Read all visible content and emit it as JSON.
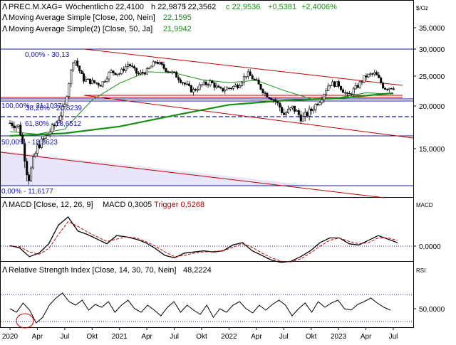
{
  "header": {
    "symbol": "PREC.M.XAG=",
    "interval": "Wöchentlich",
    "open": "o 22,4100",
    "high": "h 22,9875",
    "low": "l 22,3562",
    "close": "c 22,9536",
    "change": "+0,5381",
    "change_pct": "+2,4006%"
  },
  "legend": {
    "ma200": {
      "label": "Moving Average Simple [Close, 200, Nein]",
      "value": "22,1595"
    },
    "ma50": {
      "label": "Moving Average Simple(2) [Close, 50, Ja]",
      "value": "21,9942"
    }
  },
  "macd_title": {
    "label": "MACD [Close, 12, 26, 9]",
    "macd": "MACD 0,3005",
    "trigger": "Trigger 0,5268"
  },
  "rsi_title": {
    "label": "Relative Strength Index [Close, 14, 30, 70, Nein]",
    "value": "48,2224"
  },
  "units": {
    "price": "$/Oz",
    "macd": "MACD",
    "rsi": "RSI"
  },
  "price_ticks": [
    "35,0000",
    "30,0000",
    "25,0000",
    "20,0000",
    "15,0000"
  ],
  "macd_ticks": [
    "0,0000"
  ],
  "rsi_ticks": [
    "50,0000"
  ],
  "x_labels": [
    "2020",
    "Apr",
    "Jul",
    "Okt",
    "2021",
    "Apr",
    "Jul",
    "Okt",
    "2022",
    "Apr",
    "Jul",
    "Okt",
    "2023",
    "Apr",
    "Jul"
  ],
  "fib_labels": {
    "f0": "0,00% - 30,13",
    "f382": "38,20% - 20,8239",
    "f50": "50,00% - 18,3623",
    "f618": "61,80% - 18,6512",
    "f100": "100,00% - 21,1037",
    "fbottom": "0,00% - 11,6177"
  },
  "colors": {
    "candle": "#000000",
    "ma200": "#159015",
    "ma50": "#159015",
    "channel": "#c00000",
    "fib": "#1a1aa0",
    "macd": "#000000",
    "trigger": "#c00000",
    "rsi": "#000000"
  },
  "chart_data": [
    {
      "type": "candlestick",
      "title": "PREC.M.XAG=",
      "interval": "weekly",
      "ylim": [
        10.8,
        38.2
      ],
      "x": [
        "2020-01",
        "2020-04",
        "2020-07",
        "2020-10",
        "2021-01",
        "2021-04",
        "2021-07",
        "2021-10",
        "2022-01",
        "2022-04",
        "2022-07",
        "2022-10",
        "2023-01",
        "2023-04",
        "2023-07"
      ],
      "close_path": [
        [
          "2020-01",
          18.0
        ],
        [
          "2020-02",
          17.6
        ],
        [
          "2020-03",
          12.3
        ],
        [
          "2020-04",
          15.2
        ],
        [
          "2020-05",
          16.5
        ],
        [
          "2020-06",
          17.9
        ],
        [
          "2020-07",
          20.0
        ],
        [
          "2020-08",
          28.5
        ],
        [
          "2020-09",
          24.5
        ],
        [
          "2020-10",
          24.0
        ],
        [
          "2020-11",
          23.6
        ],
        [
          "2020-12",
          25.8
        ],
        [
          "2021-01",
          25.5
        ],
        [
          "2021-02",
          27.3
        ],
        [
          "2021-03",
          25.3
        ],
        [
          "2021-04",
          25.9
        ],
        [
          "2021-05",
          27.8
        ],
        [
          "2021-06",
          26.3
        ],
        [
          "2021-07",
          25.4
        ],
        [
          "2021-08",
          23.9
        ],
        [
          "2021-09",
          22.5
        ],
        [
          "2021-10",
          23.5
        ],
        [
          "2021-11",
          24.0
        ],
        [
          "2021-12",
          22.6
        ],
        [
          "2022-01",
          23.0
        ],
        [
          "2022-02",
          23.5
        ],
        [
          "2022-03",
          25.5
        ],
        [
          "2022-04",
          24.0
        ],
        [
          "2022-05",
          22.0
        ],
        [
          "2022-06",
          21.0
        ],
        [
          "2022-07",
          19.0
        ],
        [
          "2022-08",
          19.8
        ],
        [
          "2022-09",
          18.5
        ],
        [
          "2022-10",
          19.5
        ],
        [
          "2022-11",
          21.0
        ],
        [
          "2022-12",
          23.8
        ],
        [
          "2023-01",
          23.6
        ],
        [
          "2023-02",
          21.6
        ],
        [
          "2023-03",
          23.2
        ],
        [
          "2023-04",
          25.0
        ],
        [
          "2023-05",
          25.5
        ],
        [
          "2023-06",
          23.0
        ],
        [
          "2023-07",
          23.2
        ],
        [
          "2023-07b",
          22.95
        ]
      ],
      "ma200": [
        [
          "2020-01",
          16.5
        ],
        [
          "2020-07",
          16.8
        ],
        [
          "2021-01",
          17.6
        ],
        [
          "2021-07",
          18.9
        ],
        [
          "2022-01",
          20.2
        ],
        [
          "2022-07",
          20.9
        ],
        [
          "2023-01",
          21.3
        ],
        [
          "2023-07",
          22.1595
        ]
      ],
      "ma50": [
        [
          "2020-01",
          17.0
        ],
        [
          "2020-04",
          16.7
        ],
        [
          "2020-07",
          17.3
        ],
        [
          "2020-10",
          21.0
        ],
        [
          "2021-01",
          23.8
        ],
        [
          "2021-04",
          25.8
        ],
        [
          "2021-07",
          25.6
        ],
        [
          "2021-10",
          24.4
        ],
        [
          "2022-01",
          23.9
        ],
        [
          "2022-04",
          24.3
        ],
        [
          "2022-07",
          22.6
        ],
        [
          "2022-10",
          21.2
        ],
        [
          "2023-01",
          21.4
        ],
        [
          "2023-04",
          22.2
        ],
        [
          "2023-07",
          21.9942
        ]
      ],
      "fibonacci": [
        30.13,
        21.1037,
        20.8239,
        18.6512,
        18.3623,
        11.6177
      ],
      "channels": [
        {
          "from": [
            "2020-10",
            30.0
          ],
          "to": [
            "2023-07",
            23.2
          ]
        },
        {
          "from": [
            "2020-10",
            21.5
          ],
          "to": [
            "2023-07",
            16.2
          ]
        },
        {
          "from": [
            "2020-01",
            14.7
          ],
          "to": [
            "2023-07",
            10.3
          ]
        }
      ]
    },
    {
      "type": "line",
      "title": "MACD [Close, 12, 26, 9]",
      "series": [
        {
          "name": "MACD",
          "values": [
            0.05,
            -0.15,
            -0.9,
            -0.6,
            0.2,
            1.8,
            2.5,
            1.3,
            1.0,
            0.6,
            0.2,
            0.9,
            0.8,
            0.6,
            0.3,
            -0.2,
            -0.8,
            -1.0,
            -0.6,
            -0.5,
            -0.4,
            -0.5,
            -0.4,
            0.1,
            0.3,
            -0.4,
            -0.8,
            -1.2,
            -1.4,
            -1.3,
            -0.9,
            -0.4,
            0.3,
            0.7,
            0.7,
            0.2,
            0.1,
            0.5,
            0.9,
            0.6,
            0.3
          ]
        },
        {
          "name": "Trigger",
          "values": [
            0.0,
            -0.05,
            -0.5,
            -0.7,
            -0.2,
            1.0,
            2.1,
            1.7,
            1.2,
            0.8,
            0.4,
            0.6,
            0.8,
            0.7,
            0.4,
            0.0,
            -0.5,
            -0.9,
            -0.8,
            -0.6,
            -0.5,
            -0.45,
            -0.4,
            -0.1,
            0.2,
            -0.1,
            -0.6,
            -1.0,
            -1.3,
            -1.35,
            -1.1,
            -0.6,
            0.0,
            0.5,
            0.7,
            0.4,
            0.2,
            0.3,
            0.7,
            0.7,
            0.5
          ]
        }
      ],
      "ylim": [
        -2.0,
        3.4
      ]
    },
    {
      "type": "line",
      "title": "Relative Strength Index [Close, 14, 30, 70, Nein]",
      "series": [
        {
          "name": "RSI",
          "values": [
            50,
            45,
            58,
            48,
            30,
            38,
            55,
            65,
            72,
            60,
            55,
            62,
            48,
            56,
            52,
            60,
            45,
            55,
            62,
            50,
            45,
            55,
            48,
            40,
            52,
            60,
            45,
            55,
            48,
            42,
            55,
            38,
            50,
            45,
            55,
            60,
            50,
            44,
            55,
            48,
            56,
            62,
            55,
            40,
            50,
            58,
            45,
            60,
            52,
            58,
            62,
            50,
            48,
            56,
            60,
            65,
            58,
            52,
            48
          ]
        }
      ],
      "levels": [
        30,
        70
      ],
      "ylim": [
        24,
        90
      ]
    }
  ]
}
